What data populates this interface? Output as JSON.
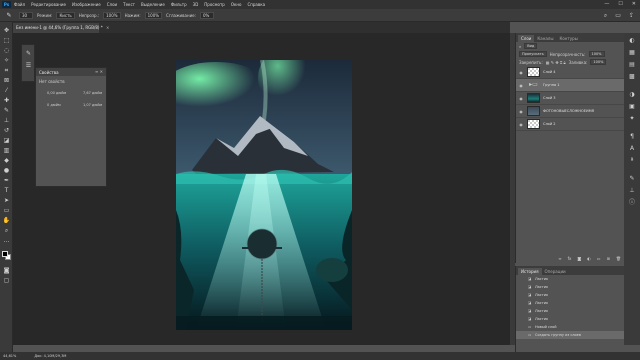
{
  "app": {
    "logo": "Ps"
  },
  "menu": [
    "Файл",
    "Редактирование",
    "Изображение",
    "Слои",
    "Текст",
    "Выделение",
    "Фильтр",
    "3D",
    "Просмотр",
    "Окно",
    "Справка"
  ],
  "window_controls": [
    "—",
    "☐",
    "✕"
  ],
  "options_bar": {
    "tool_icon": "brush-icon",
    "size": "30",
    "mode_label": "Режим:",
    "mode_value": "Кисть",
    "opacity_label": "Непрозр.:",
    "opacity_value": "100%",
    "pressure_label": "Нажим:",
    "pressure_value": "100%",
    "smoothing_label": "Сглаживание:",
    "smoothing_value": "0%"
  },
  "document_tab": {
    "title": "Без имени-1 @ 44,6% (Группа 1, RGB/8) *",
    "close": "×"
  },
  "properties_panel": {
    "title": "Свойства",
    "subtitle": "Нет свойств",
    "fields": [
      "0,00 дюйм",
      "7,67 дюйм",
      "0 дюйм",
      "1,07 дюйм"
    ]
  },
  "layers_panel": {
    "tabs": [
      "Слои",
      "Каналы",
      "Контуры"
    ],
    "filter_label": "Вид",
    "blend_mode": "Пропускать",
    "opacity_label": "Непрозрачность:",
    "opacity_value": "100%",
    "lock_label": "Закрепить:",
    "fill_label": "Заливка:",
    "fill_value": "100%",
    "layers": [
      {
        "name": "Слой 4",
        "thumb": "checker",
        "selected": false
      },
      {
        "name": "Группа 1",
        "thumb": "folder",
        "selected": true
      },
      {
        "name": "Слой 3",
        "thumb": "img",
        "selected": false
      },
      {
        "name": "ФОТОНОВЫЕСЛОЖНОЕИМЯ",
        "thumb": "img2",
        "selected": false
      },
      {
        "name": "Слой 2",
        "thumb": "checker",
        "selected": false
      }
    ],
    "footer_icons": [
      "link-icon",
      "fx-icon",
      "mask-icon",
      "adjust-icon",
      "folder-icon",
      "new-layer-icon",
      "trash-icon"
    ]
  },
  "history_panel": {
    "tabs": [
      "История",
      "Операции"
    ],
    "items": [
      "Ластик",
      "Ластик",
      "Ластик",
      "Ластик",
      "Ластик",
      "Ластик",
      "Новый слой",
      "Создать группу из слоев"
    ]
  },
  "status_bar": {
    "zoom": "44,61%",
    "doc_size": "Док: 4,10М/29,3М"
  },
  "colors": {
    "accent": "#31a8ff",
    "panel": "#535353",
    "canvas_bg": "#282828"
  }
}
